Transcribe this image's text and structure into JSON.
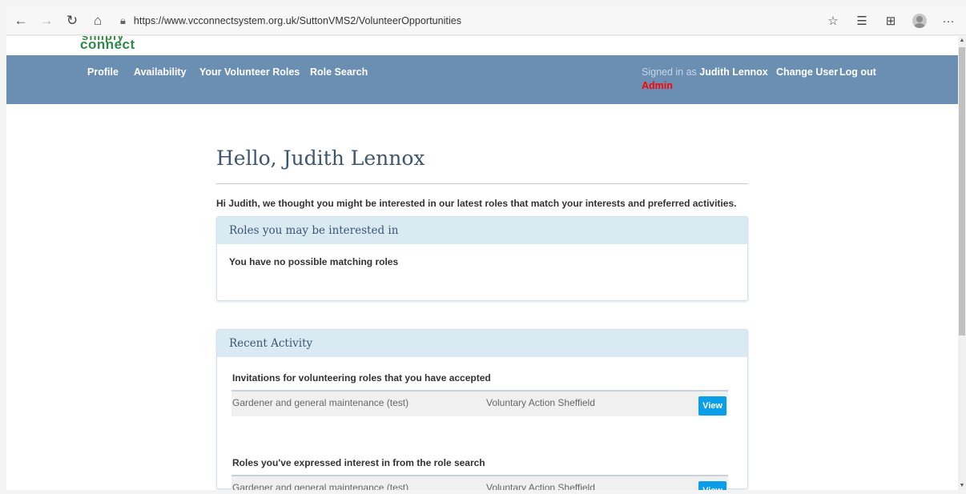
{
  "browser": {
    "url": "https://www.vcconnectsystem.org.uk/SuttonVMS2/VolunteerOpportunities"
  },
  "logo": {
    "top": "simply",
    "bottom": "connect"
  },
  "nav": {
    "profile": "Profile",
    "availability": "Availability",
    "your_roles": "Your Volunteer Roles",
    "role_search": "Role Search",
    "signed_in_prefix": "Signed in as",
    "user_name": "Judith Lennox",
    "user_role": "Admin",
    "change_user": "Change User",
    "log_out": "Log out"
  },
  "main": {
    "greeting": "Hello, Judith Lennox",
    "intro": "Hi Judith, we thought you might be interested in our latest roles that match your interests and preferred activities.",
    "roles_panel": {
      "title": "Roles you may be interested in",
      "empty_message": "You have no possible matching roles"
    },
    "activity_panel": {
      "title": "Recent Activity",
      "sections": [
        {
          "title": "Invitations for volunteering roles that you have accepted",
          "rows": [
            {
              "role": "Gardener and general maintenance (test)",
              "organisation": "Voluntary Action Sheffield",
              "action": "View"
            }
          ]
        },
        {
          "title": "Roles you've expressed interest in from the role search",
          "rows": [
            {
              "role": "Gardener and general maintenance (test)",
              "organisation": "Voluntary Action Sheffield",
              "action": "View"
            }
          ]
        }
      ]
    }
  },
  "icons": [
    "back-icon",
    "forward-icon",
    "refresh-icon",
    "home-icon",
    "lock-icon",
    "favorite-add-icon",
    "favorites-icon",
    "collections-icon",
    "profile-avatar-icon",
    "more-icon"
  ],
  "colors": {
    "nav_bar": "#6a8fb3",
    "panel_header": "#d9eaf3",
    "view_button": "#0b9ee8",
    "admin": "#ff0000"
  }
}
